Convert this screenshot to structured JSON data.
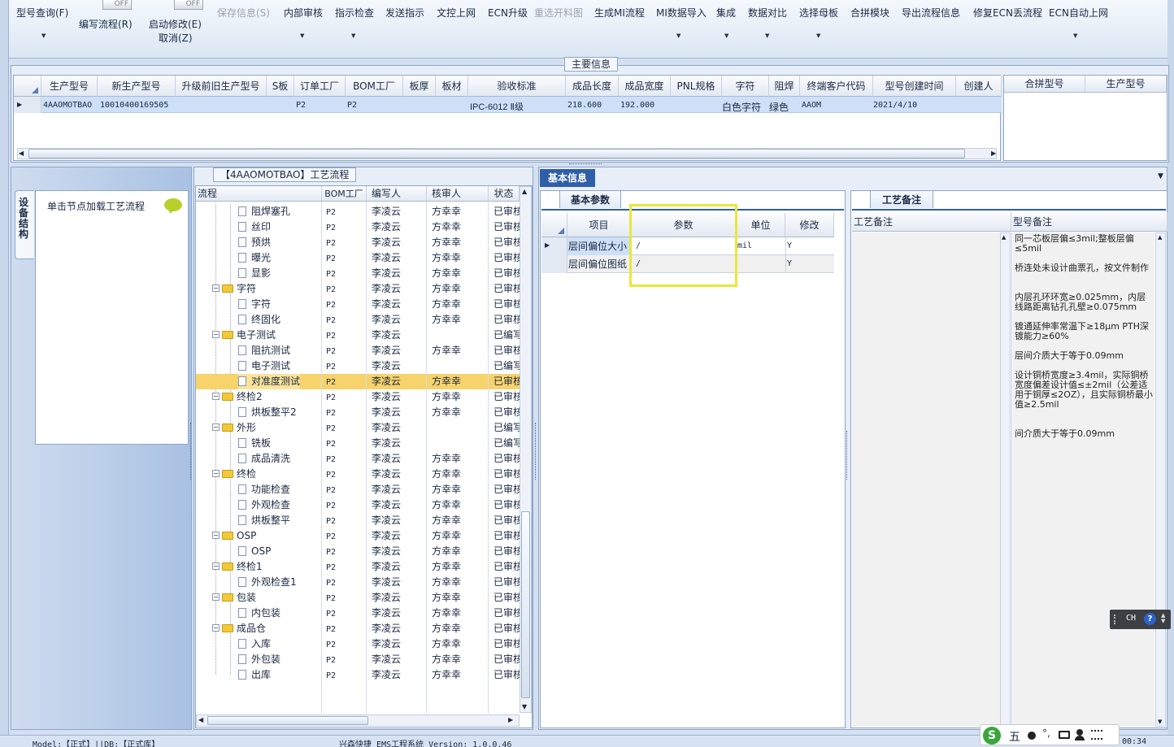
{
  "toolbar": {
    "items": [
      {
        "label": "型号查询(F)",
        "dropdown": true,
        "enabled": true
      },
      {
        "label": "编写流程(R)",
        "toggle": "OFF",
        "enabled": true
      },
      {
        "label": "启动修改(E)",
        "label2": "取消(Z)",
        "toggle": "OFF",
        "enabled": true
      },
      {
        "label": "保存信息(S)",
        "enabled": false
      },
      {
        "label": "内部审核",
        "dropdown": true,
        "enabled": true
      },
      {
        "label": "指示检查",
        "dropdown": true,
        "enabled": true
      },
      {
        "label": "发送指示",
        "enabled": true
      },
      {
        "label": "文控上网",
        "enabled": true
      },
      {
        "label": "ECN升级",
        "enabled": true
      },
      {
        "label": "重选开料图",
        "enabled": false
      },
      {
        "label": "生成MI流程",
        "enabled": true
      },
      {
        "label": "MI数据导入",
        "dropdown": true,
        "enabled": true
      },
      {
        "label": "集成",
        "dropdown": true,
        "enabled": true
      },
      {
        "label": "数据对比",
        "dropdown": true,
        "enabled": true
      },
      {
        "label": "选择母板",
        "dropdown": true,
        "enabled": true
      },
      {
        "label": "合拼模块",
        "enabled": true
      },
      {
        "label": "导出流程信息",
        "enabled": true
      },
      {
        "label": "修复ECN丢流程",
        "enabled": true
      },
      {
        "label": "ECN自动上网",
        "dropdown": true,
        "enabled": true
      }
    ]
  },
  "main_info": {
    "title": "主要信息",
    "columns": [
      "生产型号",
      "新生产型号",
      "升级前旧生产型号",
      "S板",
      "订单工厂",
      "BOM工厂",
      "板厚",
      "板材",
      "验收标准",
      "成品长度",
      "成品宽度",
      "PNL规格",
      "字符",
      "阻焊",
      "终端客户代码",
      "型号创建时间",
      "创建人"
    ],
    "row": [
      "4AAOMOTBAO",
      "10010400169505",
      "",
      "",
      "P2",
      "P2",
      "",
      "",
      "IPC-6012 Ⅱ级",
      "218.600",
      "192.000",
      "",
      "白色字符",
      "绿色",
      "AAOM",
      "2021/4/10",
      ""
    ],
    "side_columns": [
      "合拼型号",
      "生产型号"
    ]
  },
  "left_panel": {
    "vertical_tab": "设备结构",
    "hint": "单击节点加载工艺流程"
  },
  "process": {
    "title": "【4AAOMOTBAO】工艺流程",
    "columns": [
      "流程",
      "BOM工厂",
      "编写人",
      "核审人",
      "状态"
    ],
    "rows": [
      {
        "name": "阻焊塞孔",
        "level": 2,
        "bom": "P2",
        "writer": "李凌云",
        "checker": "方幸幸",
        "status": "已审核"
      },
      {
        "name": "丝印",
        "level": 2,
        "bom": "P2",
        "writer": "李凌云",
        "checker": "方幸幸",
        "status": "已审核"
      },
      {
        "name": "预烘",
        "level": 2,
        "bom": "P2",
        "writer": "李凌云",
        "checker": "方幸幸",
        "status": "已审核"
      },
      {
        "name": "曝光",
        "level": 2,
        "bom": "P2",
        "writer": "李凌云",
        "checker": "方幸幸",
        "status": "已审核"
      },
      {
        "name": "显影",
        "level": 2,
        "bom": "P2",
        "writer": "李凌云",
        "checker": "方幸幸",
        "status": "已审核"
      },
      {
        "name": "字符",
        "level": 1,
        "bom": "P2",
        "writer": "李凌云",
        "checker": "方幸幸",
        "status": "已审核"
      },
      {
        "name": "字符",
        "level": 2,
        "bom": "P2",
        "writer": "李凌云",
        "checker": "方幸幸",
        "status": "已审核"
      },
      {
        "name": "终固化",
        "level": 2,
        "bom": "P2",
        "writer": "李凌云",
        "checker": "方幸幸",
        "status": "已审核"
      },
      {
        "name": "电子测试",
        "level": 1,
        "bom": "P2",
        "writer": "李凌云",
        "checker": "",
        "status": "已编写"
      },
      {
        "name": "阻抗测试",
        "level": 2,
        "bom": "P2",
        "writer": "李凌云",
        "checker": "方幸幸",
        "status": "已审核"
      },
      {
        "name": "电子测试",
        "level": 2,
        "bom": "P2",
        "writer": "李凌云",
        "checker": "",
        "status": "已编写"
      },
      {
        "name": "对准度测试",
        "level": 2,
        "bom": "P2",
        "writer": "李凌云",
        "checker": "方幸幸",
        "status": "已审核",
        "selected": true
      },
      {
        "name": "终检2",
        "level": 1,
        "bom": "P2",
        "writer": "李凌云",
        "checker": "方幸幸",
        "status": "已审核"
      },
      {
        "name": "烘板整平2",
        "level": 2,
        "bom": "P2",
        "writer": "李凌云",
        "checker": "方幸幸",
        "status": "已审核"
      },
      {
        "name": "外形",
        "level": 1,
        "bom": "P2",
        "writer": "李凌云",
        "checker": "",
        "status": "已编写"
      },
      {
        "name": "铣板",
        "level": 2,
        "bom": "P2",
        "writer": "李凌云",
        "checker": "",
        "status": "已编写"
      },
      {
        "name": "成品清洗",
        "level": 2,
        "bom": "P2",
        "writer": "李凌云",
        "checker": "方幸幸",
        "status": "已审核"
      },
      {
        "name": "终检",
        "level": 1,
        "bom": "P2",
        "writer": "李凌云",
        "checker": "方幸幸",
        "status": "已审核"
      },
      {
        "name": "功能检查",
        "level": 2,
        "bom": "P2",
        "writer": "李凌云",
        "checker": "方幸幸",
        "status": "已审核"
      },
      {
        "name": "外观检查",
        "level": 2,
        "bom": "P2",
        "writer": "李凌云",
        "checker": "方幸幸",
        "status": "已审核"
      },
      {
        "name": "烘板整平",
        "level": 2,
        "bom": "P2",
        "writer": "李凌云",
        "checker": "方幸幸",
        "status": "已审核"
      },
      {
        "name": "OSP",
        "level": 1,
        "bom": "P2",
        "writer": "李凌云",
        "checker": "方幸幸",
        "status": "已审核"
      },
      {
        "name": "OSP",
        "level": 2,
        "bom": "P2",
        "writer": "李凌云",
        "checker": "方幸幸",
        "status": "已审核"
      },
      {
        "name": "终检1",
        "level": 1,
        "bom": "P2",
        "writer": "李凌云",
        "checker": "方幸幸",
        "status": "已审核"
      },
      {
        "name": "外观检查1",
        "level": 2,
        "bom": "P2",
        "writer": "李凌云",
        "checker": "方幸幸",
        "status": "已审核"
      },
      {
        "name": "包装",
        "level": 1,
        "bom": "P2",
        "writer": "李凌云",
        "checker": "方幸幸",
        "status": "已审核"
      },
      {
        "name": "内包装",
        "level": 2,
        "bom": "P2",
        "writer": "李凌云",
        "checker": "方幸幸",
        "status": "已审核"
      },
      {
        "name": "成品仓",
        "level": 1,
        "bom": "P2",
        "writer": "李凌云",
        "checker": "方幸幸",
        "status": "已审核"
      },
      {
        "name": "入库",
        "level": 2,
        "bom": "P2",
        "writer": "李凌云",
        "checker": "方幸幸",
        "status": "已审核"
      },
      {
        "name": "外包装",
        "level": 2,
        "bom": "P2",
        "writer": "李凌云",
        "checker": "方幸幸",
        "status": "已审核"
      },
      {
        "name": "出库",
        "level": 2,
        "bom": "P2",
        "writer": "李凌云",
        "checker": "方幸幸",
        "status": "已审核"
      }
    ]
  },
  "basic_info": {
    "tab": "基本信息",
    "subtab": "基本参数",
    "columns": [
      "项目",
      "参数",
      "单位",
      "修改"
    ],
    "rows": [
      {
        "item": "层间偏位大小",
        "param": "/",
        "unit": "mil",
        "edit": "Y"
      },
      {
        "item": "层间偏位图纸",
        "param": "/",
        "unit": "",
        "edit": "Y"
      }
    ]
  },
  "remarks": {
    "tab": "工艺备注",
    "col1": "工艺备注",
    "col2": "型号备注",
    "lines": [
      "同一芯板层偏≤3mil;整板层偏≤5mil",
      "桥连处未设计曲票孔，按文件制作",
      "内层孔环环宽≥0.025mm，内层线路距离钻孔孔壁≥0.075mm",
      "镀通延伸率常温下≥18μm PTH深镀能力≥60%",
      "层间介质大于等于0.09mm",
      "设计铜桥宽度≥3.4mil，实际铜桥宽度偏差设计值≤±2mil（公差适用于铜厚≤2OZ），且实际铜桥最小值≥2.5mil",
      "间介质大于等于0.09mm"
    ]
  },
  "ime": {
    "label": "CH"
  },
  "statusbar": {
    "left": "Model:【正式】||DB:【正式库】",
    "center": "兴森快捷 EMS工程系统 Version: 1.0.0.46",
    "right": "00:34",
    "ime_char": "五"
  },
  "colors": {
    "accent": "#2f5ea8",
    "selected_row": "#f7d36c",
    "highlight_box": "#e8e83a",
    "grid_selected": "#cde0f7"
  }
}
